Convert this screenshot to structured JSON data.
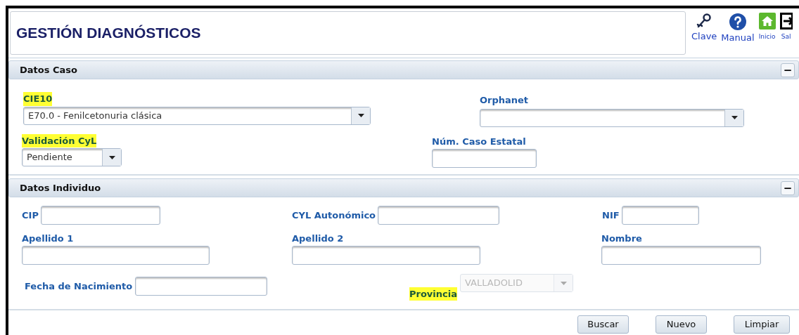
{
  "header": {
    "title": "GESTIÓN DIAGNÓSTICOS",
    "tools": [
      {
        "kind": "key",
        "label": "Clave"
      },
      {
        "kind": "help",
        "label": "Manual"
      },
      {
        "kind": "home",
        "label": "Inicio"
      },
      {
        "kind": "exit",
        "label": "Sal"
      }
    ]
  },
  "caso": {
    "title": "Datos Caso",
    "collapse": "−",
    "fields": [
      {
        "label": "CIE10",
        "highlighted": true,
        "kind": "select",
        "value": "E70.0 - Fenilcetonuria clásica",
        "disabled": false
      },
      {
        "label": "Orphanet",
        "highlighted": false,
        "kind": "select",
        "disabled": false
      },
      {
        "label": "Validación CyL",
        "highlighted": true,
        "kind": "select",
        "value": "Pendiente",
        "disabled": false
      },
      {
        "label": "Núm. Caso Estatal",
        "highlighted": false,
        "kind": "text"
      }
    ]
  },
  "individuo": {
    "title": "Datos Individuo",
    "collapse": "−",
    "fields": [
      {
        "label": "CIP",
        "highlighted": false,
        "kind": "text"
      },
      {
        "label": "CYL Autonómico",
        "highlighted": false,
        "kind": "text"
      },
      {
        "label": "NIF",
        "highlighted": false,
        "kind": "text"
      },
      {
        "label": "Apellido 1",
        "highlighted": false,
        "kind": "text"
      },
      {
        "label": "Apellido 2",
        "highlighted": false,
        "kind": "text"
      },
      {
        "label": "Nombre",
        "highlighted": false,
        "kind": "text"
      },
      {
        "label": "Fecha de Nacimiento",
        "highlighted": false,
        "kind": "text"
      },
      {
        "label": "Provincia",
        "highlighted": true,
        "kind": "select",
        "value": "VALLADOLID",
        "disabled": true
      }
    ]
  },
  "buttons": [
    "Buscar",
    "Nuevo",
    "Limpiar"
  ]
}
